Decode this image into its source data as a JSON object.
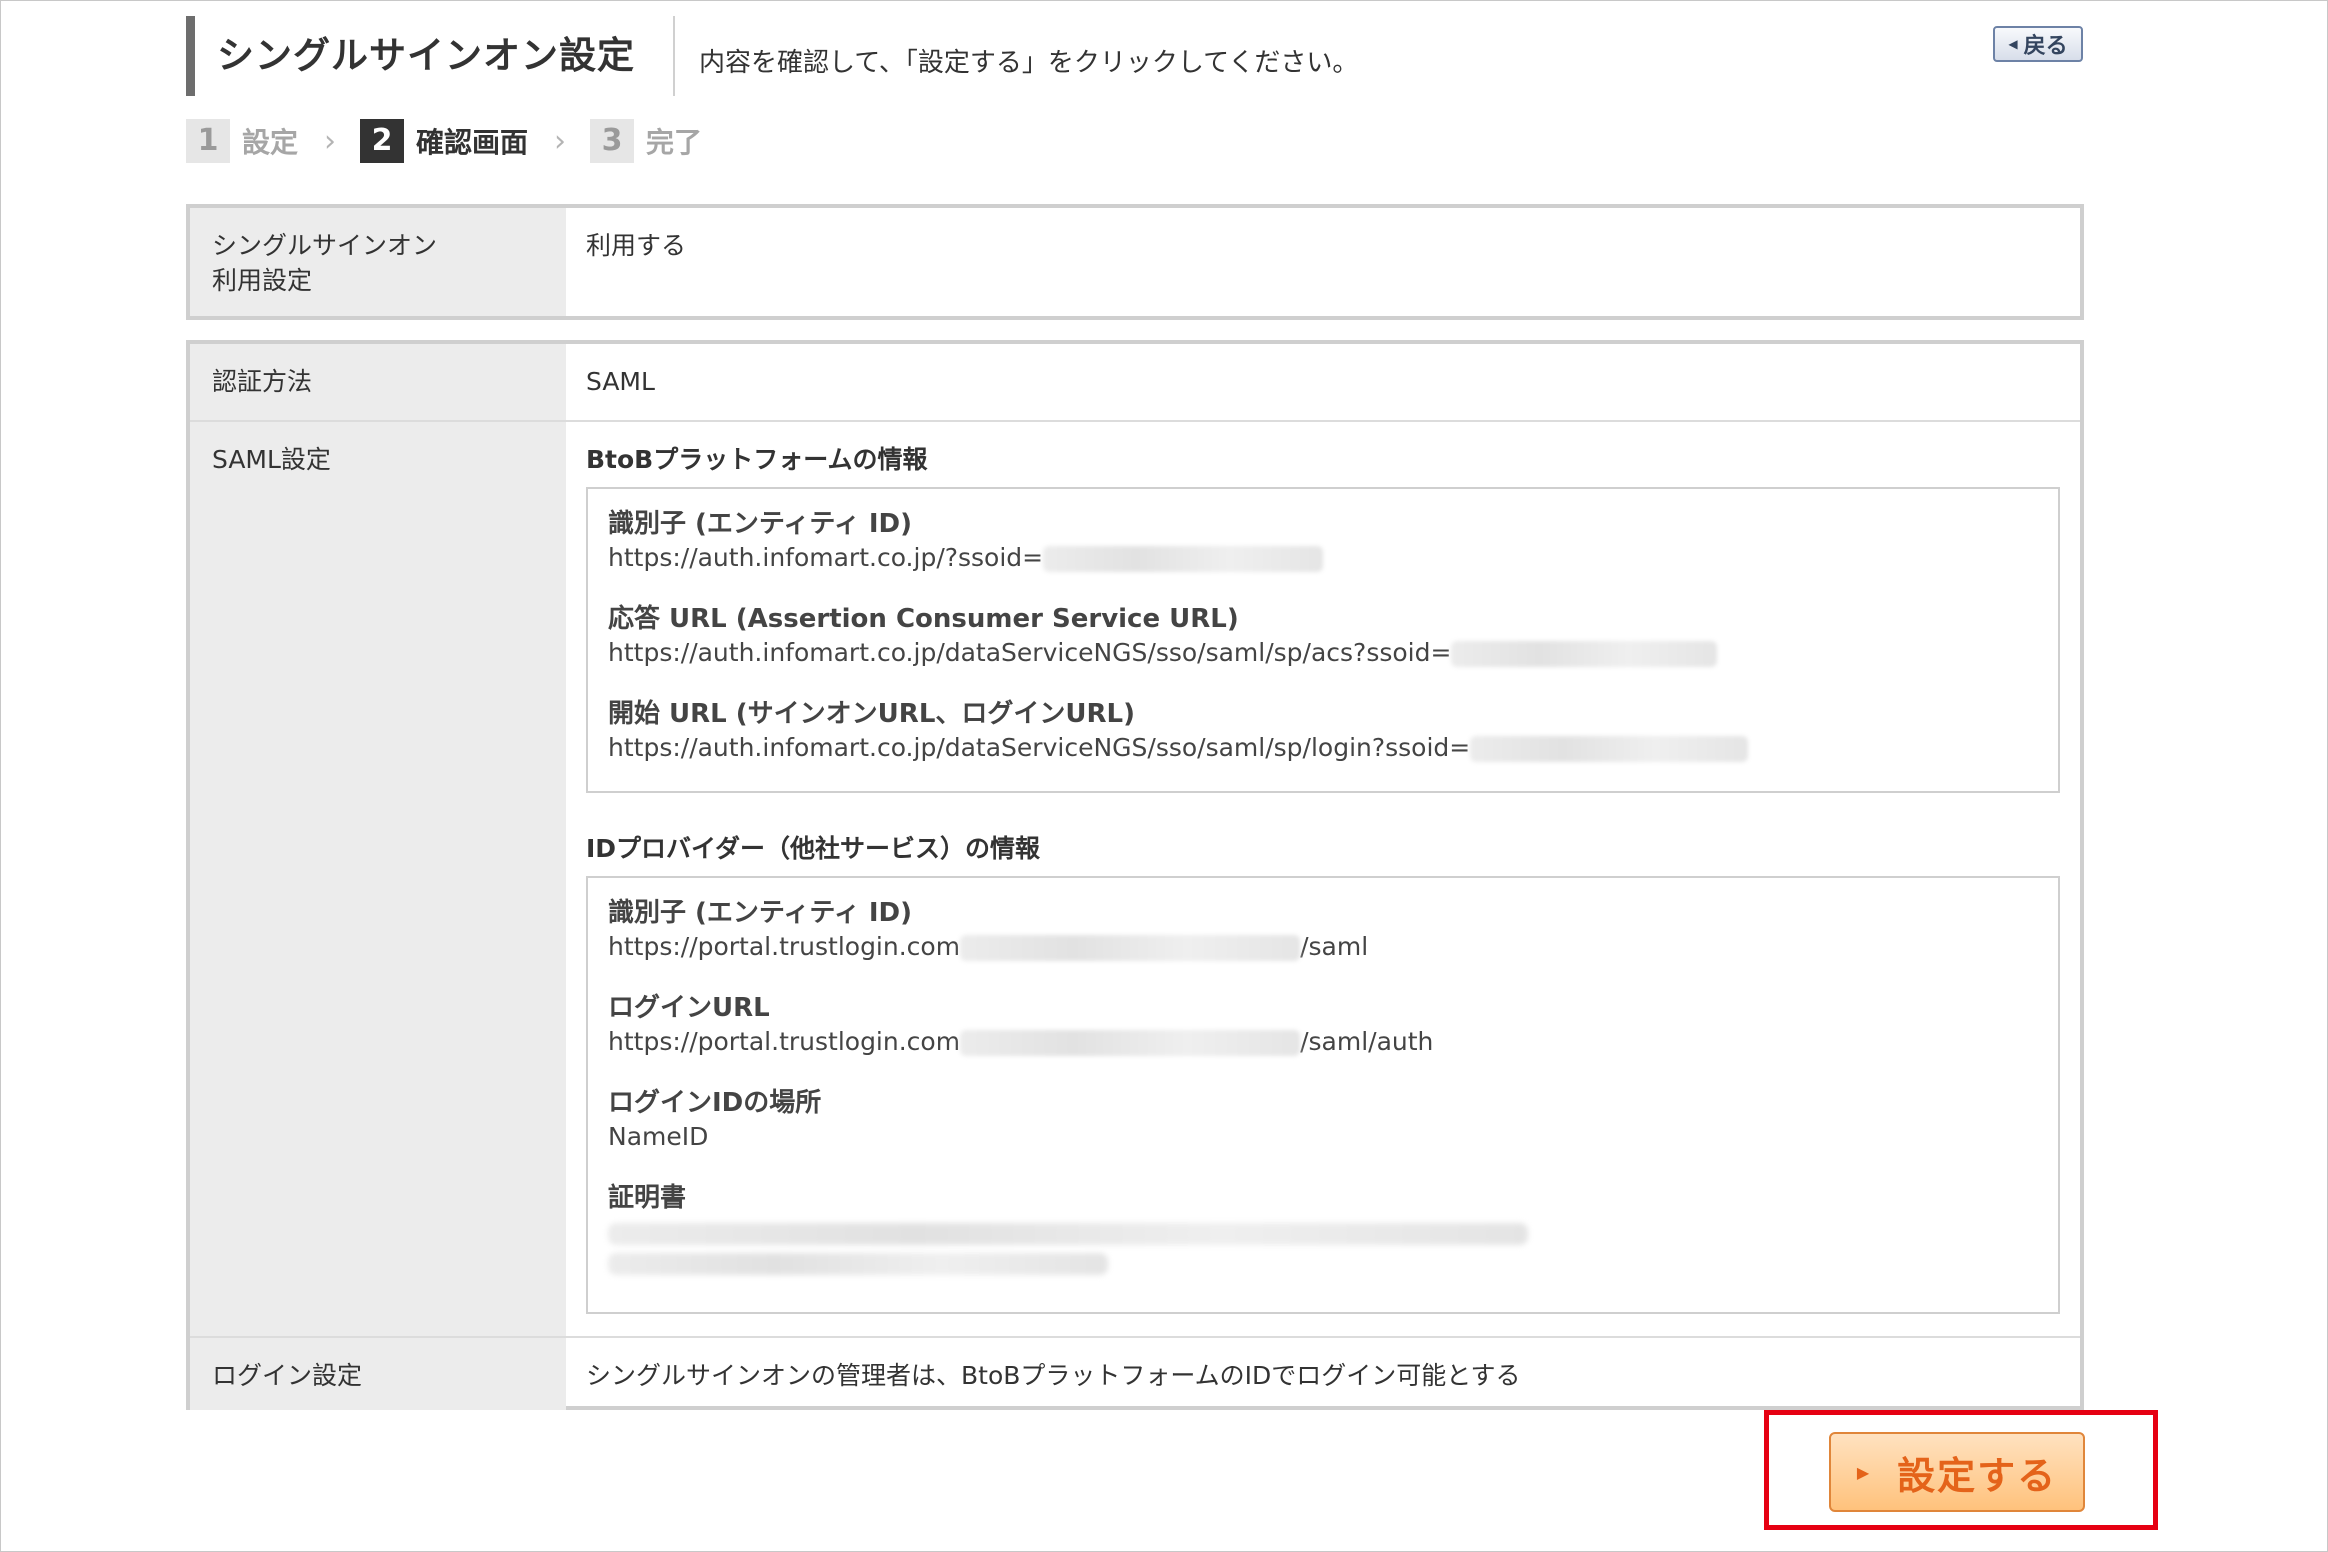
{
  "header": {
    "title": "シングルサインオン設定",
    "instruction": "内容を確認して、「設定する」をクリックしてください。",
    "back_label": "戻る"
  },
  "steps": [
    {
      "num": "1",
      "label": "設定"
    },
    {
      "num": "2",
      "label": "確認画面"
    },
    {
      "num": "3",
      "label": "完了"
    }
  ],
  "table1": {
    "row": {
      "label_line1": "シングルサインオン",
      "label_line2": "利用設定",
      "value": "利用する"
    }
  },
  "table2": {
    "auth_method": {
      "label": "認証方法",
      "value": "SAML"
    },
    "saml": {
      "label": "SAML設定",
      "btob": {
        "title": "BtoBプラットフォームの情報",
        "entity_id": {
          "label": "識別子 (エンティティ ID)",
          "value": "https://auth.infomart.co.jp/?ssoid="
        },
        "acs_url": {
          "label": "応答 URL (Assertion Consumer Service URL)",
          "value": "https://auth.infomart.co.jp/dataServiceNGS/sso/saml/sp/acs?ssoid="
        },
        "login_url": {
          "label": "開始 URL (サインオンURL、ログインURL)",
          "value": "https://auth.infomart.co.jp/dataServiceNGS/sso/saml/sp/login?ssoid="
        }
      },
      "idp": {
        "title": "IDプロバイダー（他社サービス）の情報",
        "entity_id": {
          "label": "識別子 (エンティティ ID)",
          "value_prefix": "https://portal.trustlogin.com",
          "value_suffix": "/saml"
        },
        "login_url": {
          "label": "ログインURL",
          "value_prefix": "https://portal.trustlogin.com",
          "value_suffix": "/saml/auth"
        },
        "login_id_location": {
          "label": "ログインIDの場所",
          "value": "NameID"
        },
        "certificate": {
          "label": "証明書"
        }
      }
    },
    "login_setting": {
      "label": "ログイン設定",
      "value": "シングルサインオンの管理者は、BtoBプラットフォームのIDでログイン可能とする"
    }
  },
  "submit": {
    "label": "設定する"
  },
  "colors": {
    "highlight": "#e60012",
    "submit_text": "#e4631a",
    "step_active": "#333333"
  }
}
